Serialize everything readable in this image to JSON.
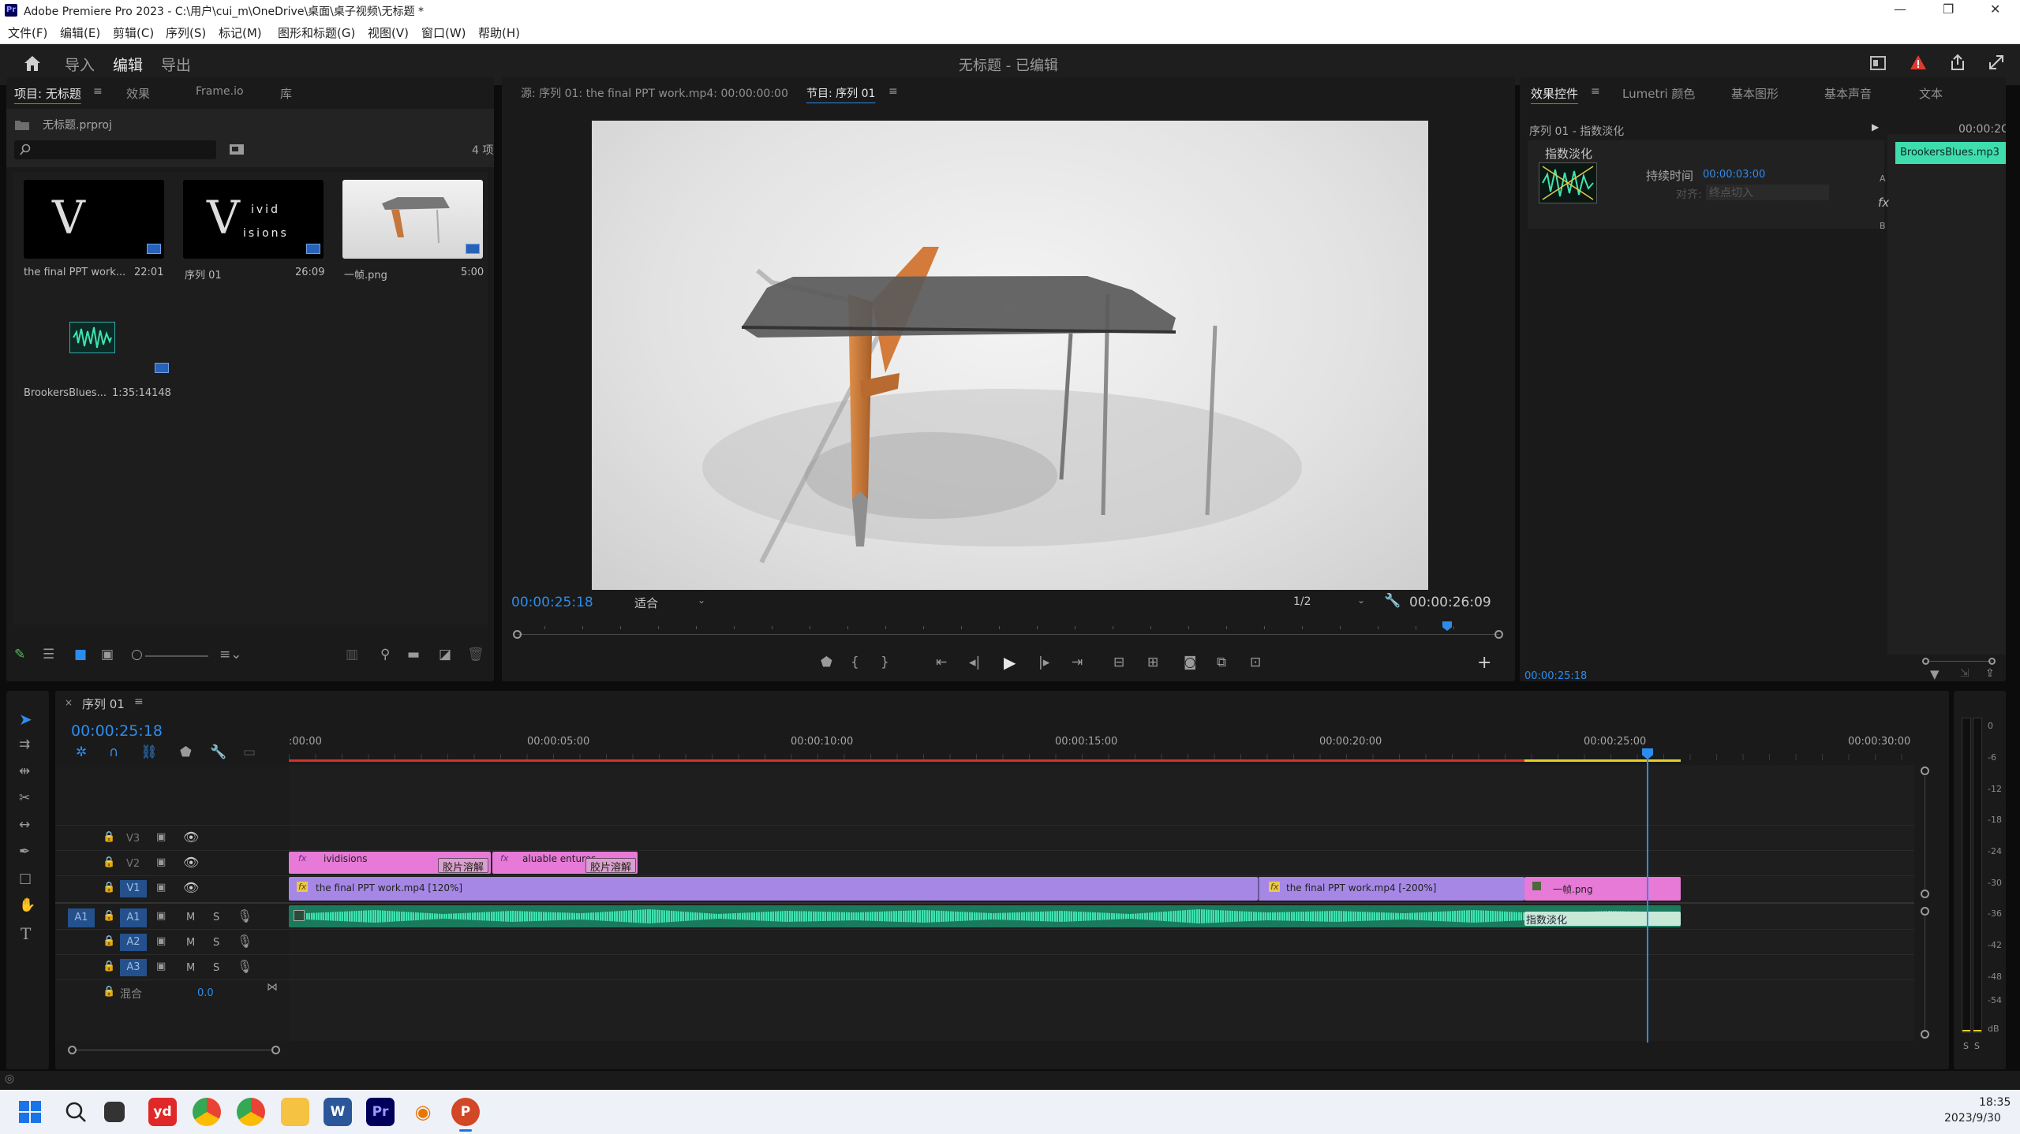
{
  "window": {
    "title": "Adobe Premiere Pro 2023 - C:\\用户\\cui_m\\OneDrive\\桌面\\桌子视频\\无标题 *",
    "app_icon": "Pr",
    "controls": [
      "—",
      "❐",
      "✕"
    ]
  },
  "menu": [
    "文件(F)",
    "编辑(E)",
    "剪辑(C)",
    "序列(S)",
    "标记(M)",
    "图形和标题(G)",
    "视图(V)",
    "窗口(W)",
    "帮助(H)"
  ],
  "header": {
    "tabs": [
      "导入",
      "编辑",
      "导出"
    ],
    "active_tab": "编辑",
    "project_title": "无标题 - 已编辑"
  },
  "project_panel": {
    "tabs": [
      "项目: 无标题",
      "效果",
      "Frame.io",
      "库"
    ],
    "file": "无标题.prproj",
    "item_count": "4 项",
    "items": [
      {
        "name": "the final PPT work...",
        "duration": "22:01"
      },
      {
        "name": "序列 01",
        "duration": "26:09"
      },
      {
        "name": "一帧.png",
        "duration": "5:00"
      },
      {
        "name": "BrookersBlues...",
        "duration": "1:35:14148"
      }
    ],
    "thumb_text": {
      "letter": "V",
      "line1": "ivid",
      "line2": "isions"
    }
  },
  "source_monitor": {
    "label": "源: 序列 01: the final PPT work.mp4: 00:00:00:00"
  },
  "program_monitor": {
    "label": "节目: 序列 01",
    "timecode": "00:00:25:18",
    "fit": "适合",
    "resolution": "1/2",
    "duration": "00:00:26:09"
  },
  "effect_controls": {
    "tabs": [
      "效果控件",
      "Lumetri 颜色",
      "基本图形",
      "基本声音",
      "文本"
    ],
    "sequence_label": "序列 01 - 指数淡化",
    "effect_name": "指数淡化",
    "duration_label": "持续时间",
    "duration_value": "00:00:03:00",
    "align_label": "对齐:",
    "align_value": "终点切入",
    "time_header": "00:00:2C",
    "clip_name": "BrookersBlues.mp3",
    "side_labels": [
      "A",
      "fx",
      "B"
    ],
    "current_time": "00:00:25:18"
  },
  "timeline": {
    "sequence_tab": "序列 01",
    "timecode": "00:00:25:18",
    "ruler": [
      ":00:00",
      "00:00:05:00",
      "00:00:10:00",
      "00:00:15:00",
      "00:00:20:00",
      "00:00:25:00",
      "00:00:30:00"
    ],
    "tracks": {
      "video": [
        "V3",
        "V2",
        "V1"
      ],
      "audio": [
        "A1",
        "A2",
        "A3"
      ],
      "source_patch": "A1",
      "mix_label": "混合",
      "mix_value": "0.0",
      "m": "M",
      "s": "S"
    },
    "clips": {
      "v2_a": "ividisions",
      "v2_a_trans": "胶片溶解",
      "v2_b": "aluable entures",
      "v2_b_trans": "胶片溶解",
      "v1_a": "the final PPT work.mp4 [120%]",
      "v1_b": "the final PPT work.mp4 [-200%]",
      "v1_c": "一帧.png",
      "a1_trans": "指数淡化",
      "fx": "fx"
    }
  },
  "audio_meter": {
    "labels": [
      "0",
      "-6",
      "-12",
      "-18",
      "-24",
      "-30",
      "-36",
      "-42",
      "-48",
      "-54",
      "dB"
    ],
    "solo": [
      "S",
      "S"
    ]
  },
  "taskbar": {
    "time": "18:35",
    "date": "2023/9/30",
    "apps": [
      "yd",
      "W",
      "Pr",
      "P"
    ]
  },
  "colors": {
    "accent": "#2d8ceb",
    "clip_purple": "#a687e6",
    "clip_pink": "#e67ad6",
    "audio_green": "#32c79a",
    "playhead": "#2d8ceb"
  }
}
